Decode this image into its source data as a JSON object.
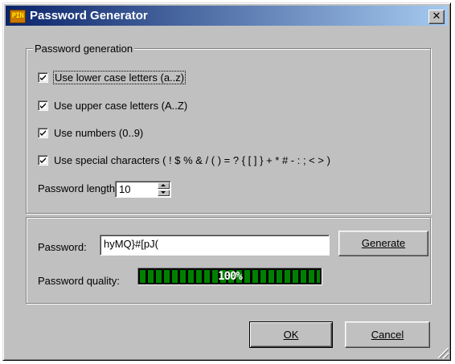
{
  "window": {
    "title": "Password Generator",
    "app_icon_text": "PIN",
    "close_glyph": "✕"
  },
  "generation_group": {
    "legend": "Password generation",
    "options": [
      {
        "label": "Use lower case letters (a..z)",
        "checked": true
      },
      {
        "label": "Use upper case letters (A..Z)",
        "checked": true
      },
      {
        "label": "Use numbers (0..9)",
        "checked": true
      },
      {
        "label": "Use special characters ( ! $ % & / ( ) = ? { [ ] } + * # - : ; < > )",
        "checked": true
      }
    ],
    "length_label": "Password length:",
    "length_value": "10"
  },
  "result_group": {
    "password_label": "Password:",
    "password_value": "hyMQ}#[pJ(",
    "generate_label": "Generate",
    "quality_label": "Password quality:",
    "quality_text": "100%",
    "quality_percent": 100,
    "quality_color": "#008000"
  },
  "footer": {
    "ok_label": "OK",
    "cancel_label": "Cancel"
  }
}
